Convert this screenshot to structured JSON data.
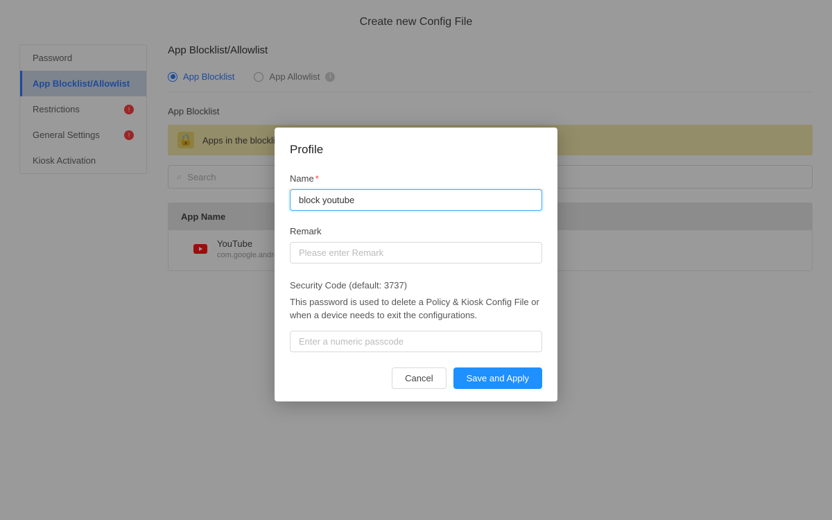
{
  "page_title": "Create new Config File",
  "sidebar": {
    "items": [
      {
        "label": "Password",
        "active": false,
        "badge": false
      },
      {
        "label": "App Blocklist/Allowlist",
        "active": true,
        "badge": false
      },
      {
        "label": "Restrictions",
        "active": false,
        "badge": true
      },
      {
        "label": "General Settings",
        "active": false,
        "badge": true
      },
      {
        "label": "Kiosk Activation",
        "active": false,
        "badge": false
      }
    ]
  },
  "main": {
    "title": "App Blocklist/Allowlist",
    "tabs": {
      "blocklist": "App Blocklist",
      "allowlist": "App Allowlist"
    },
    "section_title": "App Blocklist",
    "notice": "Apps in the blocklist can",
    "search_placeholder": "Search",
    "table": {
      "header": "App Name",
      "rows": [
        {
          "name": "YouTube",
          "package": "com.google.android.you"
        }
      ]
    }
  },
  "modal": {
    "title": "Profile",
    "name_label": "Name",
    "name_value": "block youtube",
    "remark_label": "Remark",
    "remark_placeholder": "Please enter Remark",
    "security_label": "Security Code (default: 3737)",
    "security_help": "This password is used to delete a Policy & Kiosk Config File or when a device needs to exit the configurations.",
    "security_placeholder": "Enter a numeric passcode",
    "cancel": "Cancel",
    "apply": "Save and Apply"
  }
}
